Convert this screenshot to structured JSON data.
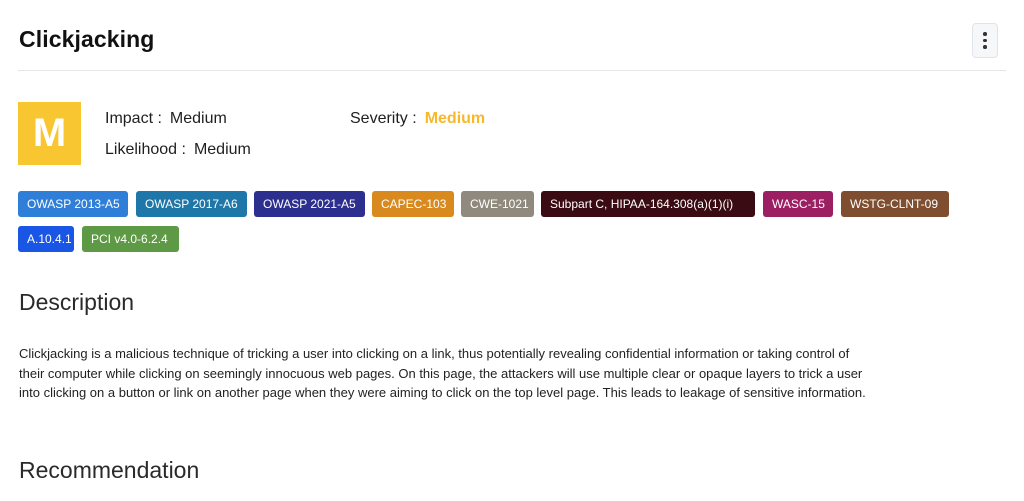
{
  "header": {
    "title": "Clickjacking"
  },
  "severity": {
    "letter": "M",
    "impact_label": "Impact :",
    "impact_value": "Medium",
    "likelihood_label": "Likelihood :",
    "likelihood_value": "Medium",
    "severity_label": "Severity :",
    "severity_value": "Medium",
    "badge_color": "#f7c631",
    "severity_value_color": "#f7b92b"
  },
  "tags": [
    {
      "label": "OWASP 2013-A5",
      "color": "#2f7fd8"
    },
    {
      "label": "OWASP 2017-A6",
      "color": "#1f76a8"
    },
    {
      "label": "OWASP 2021-A5",
      "color": "#2d2f8f"
    },
    {
      "label": "CAPEC-103",
      "color": "#d98a1f"
    },
    {
      "label": "CWE-1021",
      "color": "#8f8a7d"
    },
    {
      "label": "Subpart C, HIPAA-164.308(a)(1)(i)",
      "color": "#3a0b12"
    },
    {
      "label": "WASC-15",
      "color": "#9c1f63"
    },
    {
      "label": "WSTG-CLNT-09",
      "color": "#7f4e30"
    },
    {
      "label": "A.10.4.1",
      "color": "#1a56e6"
    },
    {
      "label": "PCI v4.0-6.2.4",
      "color": "#5e9a45"
    }
  ],
  "description": {
    "heading": "Description",
    "text": "Clickjacking is a malicious technique of tricking a user into clicking on a link, thus potentially revealing confidential information or taking control of their computer while clicking on seemingly innocuous web pages. On this page, the attackers will use multiple clear or opaque layers to trick a user into clicking on a button or link on another page when they were aiming to click on the top level page. This leads to leakage of sensitive information."
  },
  "recommendation": {
    "heading": "Recommendation"
  }
}
